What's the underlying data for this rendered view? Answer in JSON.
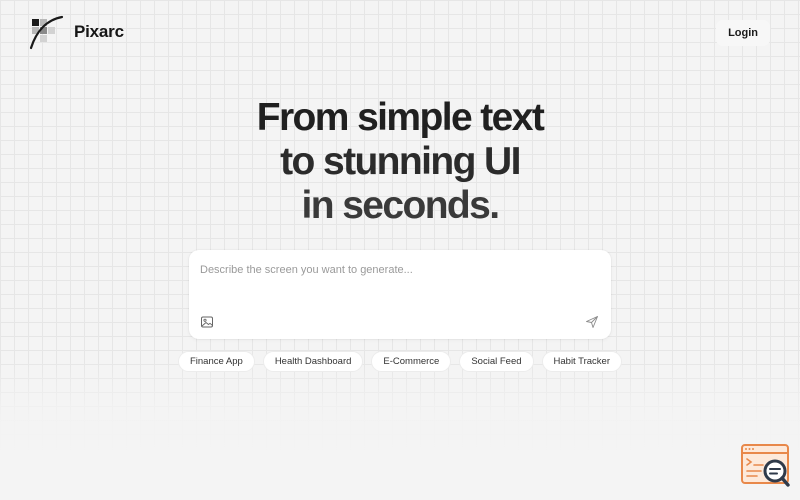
{
  "header": {
    "brand": "Pixarc",
    "login_label": "Login"
  },
  "hero": {
    "line1": "From simple text",
    "line2": "to stunning UI",
    "line3": "in seconds."
  },
  "prompt": {
    "value": "",
    "placeholder": "Describe the screen you want to generate..."
  },
  "chips": [
    "Finance App",
    "Health Dashboard",
    "E-Commerce",
    "Social Feed",
    "Habit Tracker"
  ],
  "icons": {
    "logo": "pixarc-logo-icon",
    "attach": "image-icon",
    "send": "send-icon",
    "corner": "screen-search-icon"
  },
  "colors": {
    "background": "#f4f4f4",
    "grid": "#e6e6e6",
    "text": "#1f1f1f",
    "corner_accent": "#e8884a",
    "corner_dark": "#2f3a4a"
  }
}
